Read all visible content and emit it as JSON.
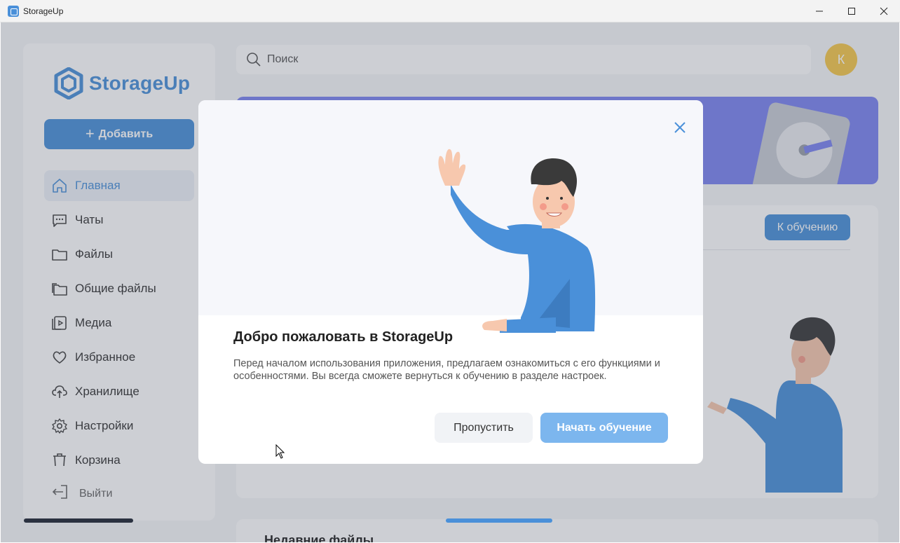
{
  "window": {
    "title": "StorageUp"
  },
  "sidebar": {
    "logo_text": "StorageUp",
    "add_button": "Добавить",
    "items": [
      {
        "label": "Главная",
        "icon": "home-icon",
        "active": true
      },
      {
        "label": "Чаты",
        "icon": "chat-icon"
      },
      {
        "label": "Файлы",
        "icon": "folder-icon"
      },
      {
        "label": "Общие файлы",
        "icon": "shared-folder-icon"
      },
      {
        "label": "Медиа",
        "icon": "media-icon"
      },
      {
        "label": "Избранное",
        "icon": "heart-icon"
      },
      {
        "label": "Хранилище",
        "icon": "cloud-upload-icon"
      },
      {
        "label": "Настройки",
        "icon": "gear-icon"
      },
      {
        "label": "Корзина",
        "icon": "trash-icon"
      }
    ],
    "logout": "Выйти"
  },
  "header": {
    "search_placeholder": "Поиск",
    "avatar_letter": "К"
  },
  "main": {
    "learn_button": "К обучению",
    "recent_title": "Недавние файлы"
  },
  "modal": {
    "title": "Добро пожаловать в StorageUp",
    "text": "Перед началом использования приложения, предлагаем ознакомиться с его функциями и особенностями. Вы всегда сможете вернуться к обучению в разделе настроек.",
    "skip_button": "Пропустить",
    "start_button": "Начать обучение"
  },
  "colors": {
    "accent": "#4a90d9",
    "accent_light": "#7cb6ee",
    "banner": "#7c84f0",
    "avatar": "#f5c84b"
  }
}
